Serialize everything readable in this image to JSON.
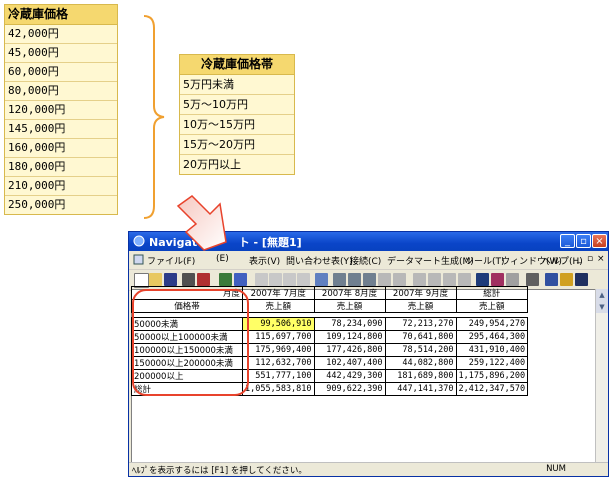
{
  "price_table": {
    "header": "冷蔵庫価格",
    "values": [
      "42,000円",
      "45,000円",
      "60,000円",
      "80,000円",
      "120,000円",
      "145,000円",
      "160,000円",
      "180,000円",
      "210,000円",
      "250,000円"
    ]
  },
  "band_table": {
    "header": "冷蔵庫価格帯",
    "values": [
      "5万円未満",
      "5万～10万円",
      "10万～15万円",
      "15万～20万円",
      "20万円以上"
    ]
  },
  "window": {
    "title": "Navigato",
    "title_suffix": "ト - [無題1]",
    "menu": [
      "ファイル(F)",
      "(E)",
      "表示(V)",
      "問い合わせ表(Y)",
      "接続(C)",
      "データマート生成(M)",
      "ツール(T)",
      "ウィンドウ(W)",
      "ヘルプ(H)"
    ],
    "mdi_controls": [
      "_",
      "▫",
      "×"
    ]
  },
  "grid": {
    "corner_top": "月度",
    "corner_bottom": "価格帯",
    "months": [
      "2007年 7月度",
      "2007年 8月度",
      "2007年 9月度",
      "総計"
    ],
    "measure": "売上額",
    "rows": [
      {
        "label": "50000未満",
        "values": [
          "99,506,910",
          "78,234,090",
          "72,213,270",
          "249,954,270"
        ]
      },
      {
        "label": "50000以上100000未満",
        "values": [
          "115,697,700",
          "109,124,800",
          "70,641,800",
          "295,464,300"
        ]
      },
      {
        "label": "100000以上150000未満",
        "values": [
          "175,969,400",
          "177,426,800",
          "78,514,200",
          "431,910,400"
        ]
      },
      {
        "label": "150000以上200000未満",
        "values": [
          "112,632,700",
          "102,407,400",
          "44,082,800",
          "259,122,400"
        ]
      },
      {
        "label": "200000以上",
        "values": [
          "551,777,100",
          "442,429,300",
          "181,689,800",
          "1,175,896,200"
        ]
      },
      {
        "label": "総計",
        "values": [
          "1,055,583,810",
          "909,622,390",
          "447,141,370",
          "2,412,347,570"
        ]
      }
    ]
  },
  "status": {
    "help_text": "ﾍﾙﾌﾟを表示するには [F1] を押してください。",
    "num_indicator": "NUM"
  },
  "colors": {
    "accent_yellow": "#f5d86f",
    "highlight": "#ffff66",
    "annotation_red": "#e8432c",
    "brace_orange": "#f0a030"
  }
}
